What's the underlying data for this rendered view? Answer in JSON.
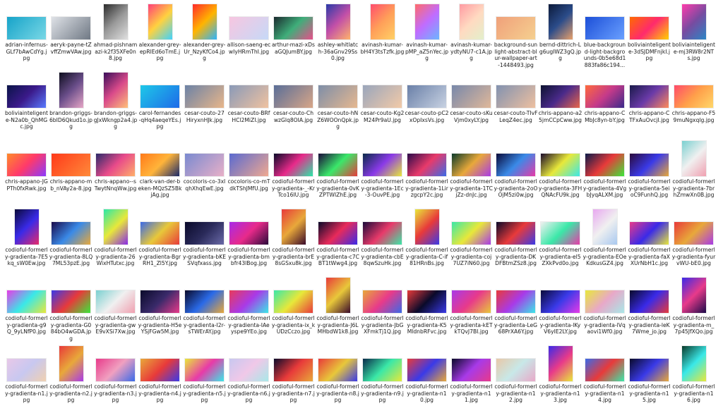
{
  "files": [
    {
      "name": "adrian-infernus-GLf7bAwCdYg.jpg",
      "orientation": "landscape",
      "colors": [
        "#16a3c9",
        "#7ad8e6"
      ]
    },
    {
      "name": "aeryk-payne-tZvffZmwVAw.jpg",
      "orientation": "landscape",
      "colors": [
        "#dfe2e7",
        "#6f7884"
      ]
    },
    {
      "name": "ahmad-pishnamazi-k2f35XFe0n8.jpg",
      "orientation": "portrait",
      "colors": [
        "#2b2b2b",
        "#9a9a9a",
        "#e0e0e0"
      ]
    },
    {
      "name": "alexander-grey-epRlEd6oTmE.jpg",
      "orientation": "portrait",
      "colors": [
        "#ff3f7a",
        "#ffd23f",
        "#3fd2ff"
      ]
    },
    {
      "name": "alexander-grey-Ur_NzyKfCo4.jpg",
      "orientation": "portrait",
      "colors": [
        "#ff2a2a",
        "#ffb400",
        "#2ab4ff"
      ]
    },
    {
      "name": "allison-saeng-ecwIyHRmThI.jpg",
      "orientation": "landscape",
      "colors": [
        "#f7c6e0",
        "#c6d9f7"
      ]
    },
    {
      "name": "arthur-mazi-xDsaGQJumBY.jpg",
      "orientation": "landscape",
      "colors": [
        "#1b2a2f",
        "#3fae7a",
        "#e84f8a"
      ]
    },
    {
      "name": "ashley-whitlatch-36aGnv29Ss0.jpg",
      "orientation": "portrait",
      "colors": [
        "#2a3aa8",
        "#c24fa8",
        "#ffb36b"
      ]
    },
    {
      "name": "avinash-kumar-bH4Y3tsTzfk.jpg",
      "orientation": "portrait",
      "colors": [
        "#ff4d6d",
        "#ff9f59",
        "#ffd166"
      ]
    },
    {
      "name": "avinash-kumar-pMP_aZ5nYec.jpg",
      "orientation": "portrait",
      "colors": [
        "#ff6b6b",
        "#c06cff",
        "#6bb6ff"
      ]
    },
    {
      "name": "avinash-kumar-ydtyNU7-c1A.jpg",
      "orientation": "portrait",
      "colors": [
        "#ff9aa2",
        "#ffdac1",
        "#e2f0cb"
      ]
    },
    {
      "name": "background-sunlight-abstract-blur-wallpaper-art-1448493.jpg",
      "orientation": "landscape",
      "colors": [
        "#f0a07a",
        "#f5d090"
      ]
    },
    {
      "name": "bernd-dittrich-Lg6ugIWZ3gQ.jpg",
      "orientation": "portrait",
      "colors": [
        "#0c1a3a",
        "#2b4c8a",
        "#e8a06b"
      ]
    },
    {
      "name": "blue-background-light-backgrounds-0b5e68d1883fa86c194...",
      "orientation": "landscape",
      "colors": [
        "#1c4fd8",
        "#6aa0ff"
      ]
    },
    {
      "name": "boliviainteligente-3dSJDMFnjkI.jpg",
      "orientation": "landscape",
      "colors": [
        "#ff6a00",
        "#ff2a6d",
        "#ffd200"
      ]
    },
    {
      "name": "boliviainteligente-mj3RW8r2NTs.jpg",
      "orientation": "portrait",
      "colors": [
        "#ff3cac",
        "#784ba0",
        "#2b86c5"
      ]
    },
    {
      "name": "boliviainteligente-N2a0b_QhMGc.jpg",
      "orientation": "landscape",
      "colors": [
        "#0a1448",
        "#3b1a8a",
        "#5a7bff"
      ]
    },
    {
      "name": "brandon-griggs-6bID6Qkud1o.jpg",
      "orientation": "portrait",
      "colors": [
        "#0e0e1e",
        "#6a4e8a",
        "#e6a6c6"
      ]
    },
    {
      "name": "brandon-griggs-gJxWkngp2a4.jpg",
      "orientation": "portrait",
      "colors": [
        "#3a0e5a",
        "#d94a8a",
        "#ffc07a"
      ]
    },
    {
      "name": "carol-fernandes-qHq4aeqeYEs.jpg",
      "orientation": "landscape",
      "colors": [
        "#1ec8e8",
        "#1e6ae8"
      ]
    },
    {
      "name": "cesar-couto-27HiryxnHJk.jpg",
      "orientation": "landscape",
      "colors": [
        "#6c82a6",
        "#e8b68a"
      ]
    },
    {
      "name": "cesar-couto-BRfHCl2MiZI.jpg",
      "orientation": "landscape",
      "colors": [
        "#8a9ab8",
        "#f0c2a0"
      ]
    },
    {
      "name": "cesar-couto-ChwzGlq8OIA.jpg",
      "orientation": "landscape",
      "colors": [
        "#5a6e98",
        "#d8a688"
      ]
    },
    {
      "name": "cesar-couto-hNZ6WOOnQpk.jpg",
      "orientation": "landscape",
      "colors": [
        "#7e8ea8",
        "#e6b890"
      ]
    },
    {
      "name": "cesar-couto-Kg2M24Pr9aU.jpg",
      "orientation": "landscape",
      "colors": [
        "#9aa6bc",
        "#f2caa8"
      ]
    },
    {
      "name": "cesar-couto-pC2xOpIxsVs.jpg",
      "orientation": "landscape",
      "colors": [
        "#6a80a8",
        "#c8d2e2"
      ]
    },
    {
      "name": "cesar-couto-sKuVjm0xyLY.jpg",
      "orientation": "landscape",
      "colors": [
        "#7888aa",
        "#e0b89a"
      ]
    },
    {
      "name": "cesar-couto-TIvFLeqZ4ec.jpg",
      "orientation": "landscape",
      "colors": [
        "#8292b0",
        "#eec0a0"
      ]
    },
    {
      "name": "chris-appano-a25jmCCpCww.jpg",
      "orientation": "landscape",
      "colors": [
        "#0c1230",
        "#4a2a8a",
        "#e8664a"
      ]
    },
    {
      "name": "chris-appano-CMbJc8yn-bY.jpg",
      "orientation": "landscape",
      "colors": [
        "#ff6a3d",
        "#c43a8a",
        "#3a2a8a"
      ]
    },
    {
      "name": "chris-appano-CTFxAuOvcjI.jpg",
      "orientation": "landscape",
      "colors": [
        "#1a1a4a",
        "#6a3aa8",
        "#ff8a5a"
      ]
    },
    {
      "name": "chris-appano-F59muNgxqlg.jpg",
      "orientation": "landscape",
      "colors": [
        "#ff4a6a",
        "#ffa04a",
        "#ffd86a"
      ]
    },
    {
      "name": "chris-appano-JGPTh0fxRwk.jpg",
      "orientation": "landscape",
      "colors": [
        "#ff8a2a",
        "#ff3a6a",
        "#8a3aff"
      ]
    },
    {
      "name": "chris-appano-mb_nVAy2a-8.jpg",
      "orientation": "landscape",
      "colors": [
        "#ff3a1a",
        "#ff8a3a"
      ]
    },
    {
      "name": "chris-appano--sTwytNnqWw.jpg",
      "orientation": "landscape",
      "colors": [
        "#2a2a6a",
        "#e84a8a",
        "#ffb06a"
      ]
    },
    {
      "name": "clark-van-der-beken-MQzSZ5BkjAg.jpg",
      "orientation": "landscape",
      "colors": [
        "#ff7a1a",
        "#ffb43a",
        "#1a2a6a"
      ]
    },
    {
      "name": "cocoloris-co-3xIqhXhqEwE.jpg",
      "orientation": "landscape",
      "colors": [
        "#7a8ad0",
        "#e8b0c8"
      ]
    },
    {
      "name": "cocoloris-co-mTdkTShJMfU.jpg",
      "orientation": "landscape",
      "colors": [
        "#5a6ad0",
        "#f0a890"
      ]
    },
    {
      "name": "codioful-formerly-gradienta-_-KrTco16IU.jpg",
      "orientation": "landscape",
      "colors": [
        "#0a0a2a",
        "#e82a8a",
        "#2ae8a8"
      ]
    },
    {
      "name": "codioful-formerly-gradienta-0vKZPTWIZhE.jpg",
      "orientation": "landscape",
      "colors": [
        "#1a0a3a",
        "#3ae86a",
        "#e83a3a"
      ]
    },
    {
      "name": "codioful-formerly-gradienta-1Ec-3-OuvPE.jpg",
      "orientation": "landscape",
      "colors": [
        "#0a2a4a",
        "#8a3ae8",
        "#e8e83a"
      ]
    },
    {
      "name": "codioful-formerly-gradienta-1LirzgcpY2c.jpg",
      "orientation": "landscape",
      "colors": [
        "#2a0a4a",
        "#e83a6a",
        "#3a6ae8"
      ]
    },
    {
      "name": "codioful-formerly-gradienta-1TCjZz-dnJc.jpg",
      "orientation": "landscape",
      "colors": [
        "#0a3a2a",
        "#e8a83a",
        "#a83ae8"
      ]
    },
    {
      "name": "codioful-formerly-gradienta-2oOOjM5zi0w.jpg",
      "orientation": "landscape",
      "colors": [
        "#0a0a3a",
        "#3a8ae8",
        "#e83aa8"
      ]
    },
    {
      "name": "codioful-formerly-gradienta-3FHQNAcFU9k.jpg",
      "orientation": "landscape",
      "colors": [
        "#1a0a2a",
        "#e8e83a",
        "#3ae8e8"
      ]
    },
    {
      "name": "codioful-formerly-gradienta-4VgbJyqALXM.jpg",
      "orientation": "landscape",
      "colors": [
        "#0a1a4a",
        "#e83a3a",
        "#3ae83a"
      ]
    },
    {
      "name": "codioful-formerly-gradienta-5eioC9FunhQ.jpg",
      "orientation": "landscape",
      "colors": [
        "#2a0a3a",
        "#3a3ae8",
        "#e8a83a"
      ]
    },
    {
      "name": "codioful-formerly-gradienta-7brhZmwXn0B.jpg",
      "orientation": "portrait",
      "colors": [
        "#7ad0d0",
        "#f0f0f0",
        "#f0a0b0"
      ]
    },
    {
      "name": "codioful-formerly-gradienta-7E5kq_sW0Ew.jpg",
      "orientation": "portrait",
      "colors": [
        "#0a0a3a",
        "#3a2ae8",
        "#e82a6a"
      ]
    },
    {
      "name": "codioful-formerly-gradienta-8LQ7ML53pzE.jpg",
      "orientation": "landscape",
      "colors": [
        "#1a0a4a",
        "#3a8ae8",
        "#e8a83a"
      ]
    },
    {
      "name": "codioful-formerly-gradienta-26WixHTutxc.jpg",
      "orientation": "portrait",
      "colors": [
        "#2ae8a8",
        "#e8e83a",
        "#8a2ae8"
      ]
    },
    {
      "name": "codioful-formerly-gradienta-BgrRH1_Zl5Y.jpg",
      "orientation": "landscape",
      "colors": [
        "#3a6ae8",
        "#e8c83a",
        "#e83a3a"
      ]
    },
    {
      "name": "codioful-formerly-gradienta-bKESVqfxass.jpg",
      "orientation": "landscape",
      "colors": [
        "#0a0a2a",
        "#2a2a5a",
        "#6a6aa8"
      ]
    },
    {
      "name": "codioful-formerly-gradienta-bmbfr43lBog.jpg",
      "orientation": "landscape",
      "colors": [
        "#a82ae8",
        "#e82a8a",
        "#2a0a3a"
      ]
    },
    {
      "name": "codioful-formerly-gradienta-brE8sGSxu8k.jpg",
      "orientation": "portrait",
      "colors": [
        "#e83a3a",
        "#e8a83a",
        "#3a0a2a"
      ]
    },
    {
      "name": "codioful-formerly-gradienta-c7CBT1tWwg4.jpg",
      "orientation": "landscape",
      "colors": [
        "#0a0a2a",
        "#e82a5a",
        "#3a2ae8"
      ]
    },
    {
      "name": "codioful-formerly-gradienta-cbE8qwSzuHk.jpg",
      "orientation": "landscape",
      "colors": [
        "#1a0a3a",
        "#e83a6a",
        "#3ae8a8"
      ]
    },
    {
      "name": "codioful-formerly-gradienta-C-if81HRnBs.jpg",
      "orientation": "portrait",
      "colors": [
        "#e8e83a",
        "#e83a3a",
        "#3a3ae8"
      ]
    },
    {
      "name": "codioful-formerly-gradienta-coj7UZ7iN60.jpg",
      "orientation": "landscape",
      "colors": [
        "#3ae8a8",
        "#e8e83a",
        "#a83ae8"
      ]
    },
    {
      "name": "codioful-formerly-gradienta-DKDFBtmZSz8.jpg",
      "orientation": "landscape",
      "colors": [
        "#0a0a2a",
        "#e83a3a",
        "#3a3ae8"
      ]
    },
    {
      "name": "codioful-formerly-gradienta-el5ZXkPvd0o.jpg",
      "orientation": "landscape",
      "colors": [
        "#f0f0f0",
        "#3ae8a8",
        "#e83aa8"
      ]
    },
    {
      "name": "codioful-formerly-gradienta-EOeKdkusGZ4.jpg",
      "orientation": "portrait",
      "colors": [
        "#e8a8f0",
        "#f0f0f0",
        "#a8c8f0"
      ]
    },
    {
      "name": "codioful-formerly-gradienta-faXXUrNbH1c.jpg",
      "orientation": "landscape",
      "colors": [
        "#e83a8a",
        "#3a2ae8",
        "#e8e83a"
      ]
    },
    {
      "name": "codioful-formerly-gradienta-fyurvWU-bE0.jpg",
      "orientation": "landscape",
      "colors": [
        "#e83a3a",
        "#e8a83a",
        "#a83ae8"
      ]
    },
    {
      "name": "codioful-formerly-gradienta-g9Q_9yLNfP0.jpg",
      "orientation": "landscape",
      "colors": [
        "#e83ae8",
        "#3ae8e8",
        "#e8e83a"
      ]
    },
    {
      "name": "codioful-formerly-gradienta-G084bO4wGDA.jpg",
      "orientation": "landscape",
      "colors": [
        "#3a3ae8",
        "#e83a3a",
        "#3ae83a"
      ]
    },
    {
      "name": "codioful-formerly-gradienta-gwE9vXSi7Xw.jpg",
      "orientation": "landscape",
      "colors": [
        "#7ad0d0",
        "#f0f0f0",
        "#f0a0b0"
      ]
    },
    {
      "name": "codioful-formerly-gradienta-H5eYSjFGw5M.jpg",
      "orientation": "landscape",
      "colors": [
        "#0a0a2a",
        "#3a2a6a",
        "#e83a8a"
      ]
    },
    {
      "name": "codioful-formerly-gradienta-I2r-sTWErAY.jpg",
      "orientation": "landscape",
      "colors": [
        "#0a0a2a",
        "#2a6ae8",
        "#e8a83a"
      ]
    },
    {
      "name": "codioful-formerly-gradienta-IAeyspe9YEo.jpg",
      "orientation": "landscape",
      "colors": [
        "#e83a5a",
        "#a83ae8",
        "#3ae8e8"
      ]
    },
    {
      "name": "codioful-formerly-gradienta-ix_kUDzCczo.jpg",
      "orientation": "landscape",
      "colors": [
        "#3ae8a8",
        "#e8e83a",
        "#e83a3a"
      ]
    },
    {
      "name": "codioful-formerly-gradienta-J6LMHbdW1k8.jpg",
      "orientation": "portrait",
      "colors": [
        "#e83a3a",
        "#e8c83a",
        "#3a0a2a"
      ]
    },
    {
      "name": "codioful-formerly-gradienta-JbGXFmkTj1Q.jpg",
      "orientation": "landscape",
      "colors": [
        "#e8a83a",
        "#e83a8a",
        "#3a6ae8"
      ]
    },
    {
      "name": "codioful-formerly-gradienta-K5MldnbRFvc.jpg",
      "orientation": "landscape",
      "colors": [
        "#e83a3a",
        "#0a0a2a",
        "#3a3ae8"
      ]
    },
    {
      "name": "codioful-formerly-gradienta-kETkTQvJ7BI.jpg",
      "orientation": "landscape",
      "colors": [
        "#a83ae8",
        "#e83a8a",
        "#e8c83a"
      ]
    },
    {
      "name": "codioful-formerly-gradienta-LeG68PrXA6Y.jpg",
      "orientation": "landscape",
      "colors": [
        "#e83a3a",
        "#a83ae8",
        "#3ae8e8"
      ]
    },
    {
      "name": "codioful-formerly-gradienta-lKyV6yIE2LY.jpg",
      "orientation": "landscape",
      "colors": [
        "#0a0a3a",
        "#3a3ae8",
        "#e83ae8"
      ]
    },
    {
      "name": "codioful-formerly-gradienta-lVqaovi1Wf0.jpg",
      "orientation": "landscape",
      "colors": [
        "#e8e83a",
        "#e8a8c8",
        "#a8e8e8"
      ]
    },
    {
      "name": "codioful-formerly-gradienta-leK7Wme_jo.jpg",
      "orientation": "landscape",
      "colors": [
        "#0a0a2a",
        "#3a2ae8",
        "#e83a3a"
      ]
    },
    {
      "name": "codioful-formerly-gradienta-m_7p45JfXQo.jpg",
      "orientation": "portrait",
      "colors": [
        "#3a2ae8",
        "#e83a8a",
        "#1a0a4a"
      ]
    },
    {
      "name": "codioful-formerly-gradienta-n1.jpg",
      "orientation": "landscape",
      "colors": [
        "#e8c8e8",
        "#c8c8f0",
        "#f0d0b0"
      ]
    },
    {
      "name": "codioful-formerly-gradienta-n2.jpg",
      "orientation": "portrait",
      "colors": [
        "#e83a3a",
        "#e8a83a",
        "#a83ae8"
      ]
    },
    {
      "name": "codioful-formerly-gradienta-n3.jpg",
      "orientation": "landscape",
      "colors": [
        "#e83a8a",
        "#f0a0c0",
        "#3a6ae8"
      ]
    },
    {
      "name": "codioful-formerly-gradienta-n4.jpg",
      "orientation": "landscape",
      "colors": [
        "#e8a83a",
        "#e83a3a",
        "#3a3ae8"
      ]
    },
    {
      "name": "codioful-formerly-gradienta-n5.jpg",
      "orientation": "landscape",
      "colors": [
        "#e8e83a",
        "#e83aa8",
        "#3ae8e8"
      ]
    },
    {
      "name": "codioful-formerly-gradienta-n6.jpg",
      "orientation": "landscape",
      "colors": [
        "#c8c8f0",
        "#f0c8e8",
        "#a8e8e8"
      ]
    },
    {
      "name": "codioful-formerly-gradienta-n7.jpg",
      "orientation": "landscape",
      "colors": [
        "#0a0a2a",
        "#e83a3a",
        "#e8a83a"
      ]
    },
    {
      "name": "codioful-formerly-gradienta-n8.jpg",
      "orientation": "landscape",
      "colors": [
        "#e83a3a",
        "#e8c83a",
        "#3a3ae8"
      ]
    },
    {
      "name": "codioful-formerly-gradienta-n9.jpg",
      "orientation": "landscape",
      "colors": [
        "#0a2a4a",
        "#3ae8a8",
        "#e8e83a"
      ]
    },
    {
      "name": "codioful-formerly-gradienta-n10.jpg",
      "orientation": "landscape",
      "colors": [
        "#e83a3a",
        "#3a3ae8",
        "#e8a83a"
      ]
    },
    {
      "name": "codioful-formerly-gradienta-n11.jpg",
      "orientation": "landscape",
      "colors": [
        "#0a0a2a",
        "#a83ae8",
        "#e83a8a"
      ]
    },
    {
      "name": "codioful-formerly-gradienta-n12.jpg",
      "orientation": "landscape",
      "colors": [
        "#e8c8a8",
        "#c8e8e8",
        "#e8a8c8"
      ]
    },
    {
      "name": "codioful-formerly-gradienta-n13.jpg",
      "orientation": "portrait",
      "colors": [
        "#3a2ae8",
        "#e83a8a",
        "#e8e83a"
      ]
    },
    {
      "name": "codioful-formerly-gradienta-n14.jpg",
      "orientation": "landscape",
      "colors": [
        "#3a6ae8",
        "#e83a3a",
        "#3ae8a8"
      ]
    },
    {
      "name": "codioful-formerly-gradienta-n15.jpg",
      "orientation": "landscape",
      "colors": [
        "#0a0a2a",
        "#3a3ae8",
        "#e8a83a"
      ]
    },
    {
      "name": "codioful-formerly-gradienta-n16.jpg",
      "orientation": "portrait",
      "colors": [
        "#0a3a2a",
        "#3ae8e8",
        "#e8e83a"
      ]
    }
  ]
}
